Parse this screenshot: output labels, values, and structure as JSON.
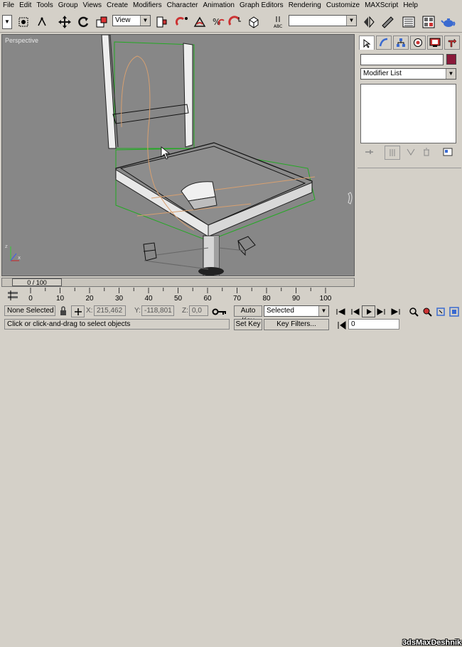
{
  "menu": [
    "File",
    "Edit",
    "Tools",
    "Group",
    "Views",
    "Create",
    "Modifiers",
    "Character",
    "Animation",
    "Graph Editors",
    "Rendering",
    "Customize",
    "MAXScript",
    "Help"
  ],
  "toolbar": {
    "view_combo": "View",
    "named_sel_combo": ""
  },
  "viewport": {
    "label": "Perspective"
  },
  "command_panel": {
    "modifier_list": "Modifier List",
    "object_name": ""
  },
  "timeline": {
    "frame_display": "0 / 100",
    "ticks": [
      "0",
      "10",
      "20",
      "30",
      "40",
      "50",
      "60",
      "70",
      "80",
      "90",
      "100"
    ]
  },
  "status": {
    "selection": "None Selected",
    "x_label": "X:",
    "x_value": "215,462",
    "y_label": "Y:",
    "y_value": "-118,801",
    "z_label": "Z:",
    "z_value": "0,0",
    "auto_key": "Auto Key",
    "key_mode": "Selected",
    "prompt": "Click or click-and-drag to select objects",
    "set_key": "Set Key",
    "key_filters": "Key Filters...",
    "current_frame": "0"
  },
  "watermark": "3dsMaxDeshnik",
  "colors": {
    "viewport_bg": "#878787",
    "object_color": "#8a1a3a",
    "wire_green": "#22aa22"
  }
}
